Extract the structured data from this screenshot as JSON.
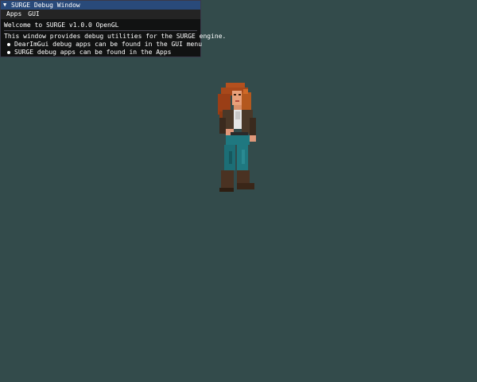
{
  "window": {
    "title": "SURGE Debug Window",
    "collapse_icon": "triangle-down-icon",
    "menu": [
      "Apps",
      "GUI"
    ],
    "welcome": "Welcome to SURGE v1.0.0 OpenGL",
    "description": "This window provides debug utilities for the SURGE engine.",
    "bullets": [
      "DearImGui debug apps can be found in the GUI menu",
      "SURGE debug apps can be found in the Apps"
    ]
  },
  "colors": {
    "background": "#334b4b",
    "titlebar": "#294a7a",
    "window_bg": "#0f0f0f",
    "text": "#ffffff"
  },
  "scene": {
    "sprite": "pixel-art-character-sprite"
  }
}
